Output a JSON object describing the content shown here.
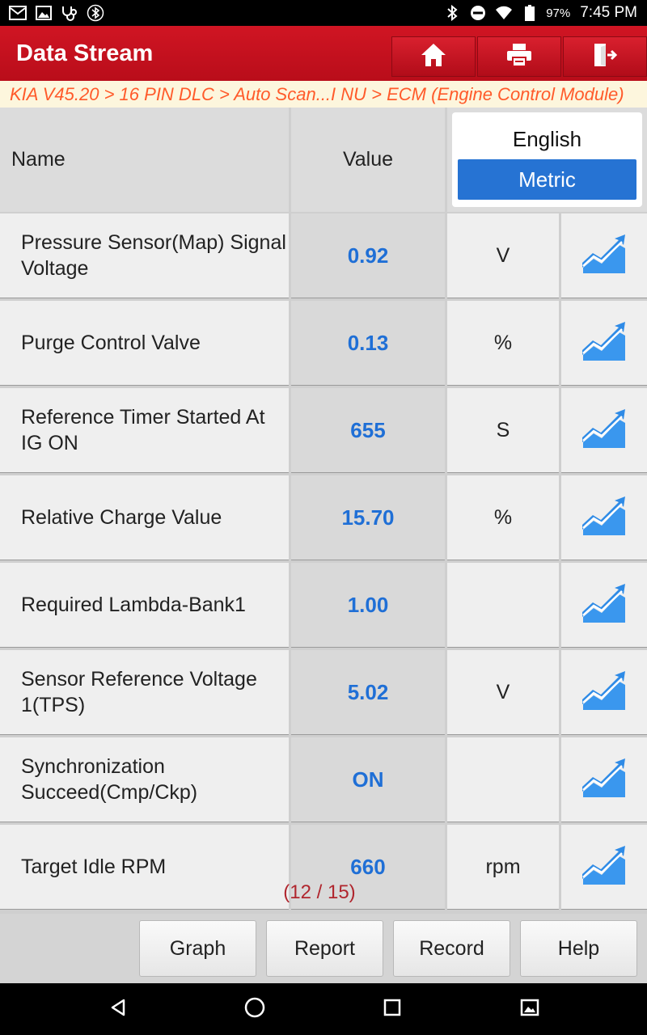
{
  "status_bar": {
    "left_icons": [
      "gmail-icon",
      "image-icon",
      "stethoscope-icon",
      "bluetooth-circle-icon"
    ],
    "right_icons": [
      "bluetooth-icon",
      "do-not-disturb-icon",
      "wifi-icon",
      "battery-icon"
    ],
    "battery": "97%",
    "time": "7:45 PM"
  },
  "header": {
    "title": "Data Stream",
    "buttons": [
      "home-icon",
      "print-icon",
      "exit-icon"
    ],
    "accent_color": "#c8111f"
  },
  "breadcrumb": "KIA V45.20 > 16 PIN DLC > Auto Scan...I NU > ECM (Engine Control Module)",
  "table": {
    "columns": {
      "name": "Name",
      "value": "Value"
    },
    "unit_toggle": {
      "english": "English",
      "metric": "Metric",
      "selected": "Metric"
    },
    "rows": [
      {
        "name": "Pressure Sensor(Map) Signal Voltage",
        "value": "0.92",
        "unit": "V"
      },
      {
        "name": "Purge Control Valve",
        "value": "0.13",
        "unit": "%"
      },
      {
        "name": "Reference Timer Started At IG ON",
        "value": "655",
        "unit": "S"
      },
      {
        "name": "Relative Charge Value",
        "value": "15.70",
        "unit": "%"
      },
      {
        "name": "Required Lambda-Bank1",
        "value": "1.00",
        "unit": ""
      },
      {
        "name": "Sensor Reference Voltage 1(TPS)",
        "value": "5.02",
        "unit": "V"
      },
      {
        "name": "Synchronization Succeed(Cmp/Ckp)",
        "value": "ON",
        "unit": ""
      },
      {
        "name": "Target Idle RPM",
        "value": "660",
        "unit": "rpm"
      }
    ],
    "value_color": "#1f6fd6"
  },
  "page_indicator": "(12 / 15)",
  "actions": {
    "graph": "Graph",
    "report": "Report",
    "record": "Record",
    "help": "Help"
  },
  "nav_bar": [
    "back-icon",
    "home-circle-icon",
    "recents-icon",
    "screenshot-icon"
  ]
}
